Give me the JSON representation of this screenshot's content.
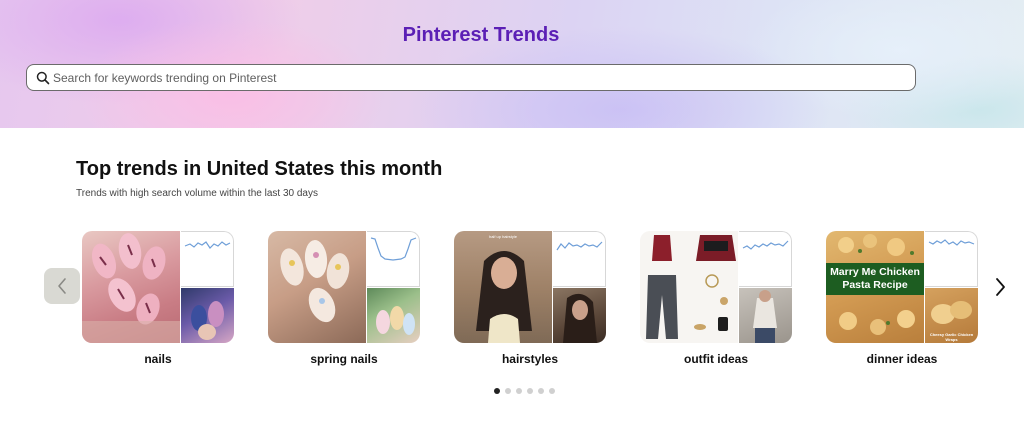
{
  "hero": {
    "title": "Pinterest Trends",
    "search_placeholder": "Search for keywords trending on Pinterest"
  },
  "section": {
    "title": "Top trends in United States this month",
    "subtitle": "Trends with high search volume within the last 30 days"
  },
  "trends": [
    {
      "label": "nails",
      "trend_shape": "volatile-high"
    },
    {
      "label": "spring nails",
      "trend_shape": "u-shaped"
    },
    {
      "label": "hairstyles",
      "trend_shape": "volatile-high"
    },
    {
      "label": "outfit ideas",
      "trend_shape": "volatile-high"
    },
    {
      "label": "dinner ideas",
      "trend_shape": "volatile-high"
    }
  ],
  "image_text": {
    "dinner_overlay": "Marry Me Chicken Pasta Recipe",
    "dinner_small_caption": "Cheesy Garlic Chicken Wraps",
    "hairstyles_caption": "half up hairstyle"
  },
  "carousel": {
    "page_count": 6,
    "active_page": 1
  },
  "colors": {
    "brand_purple": "#5b1fb5",
    "sparkline_blue": "#6f9fd8",
    "dot_active": "#222222",
    "dot_inactive": "#d0d0d0"
  },
  "icons": {
    "search": "search-icon",
    "prev": "chevron-left-icon",
    "next": "chevron-right-icon"
  }
}
